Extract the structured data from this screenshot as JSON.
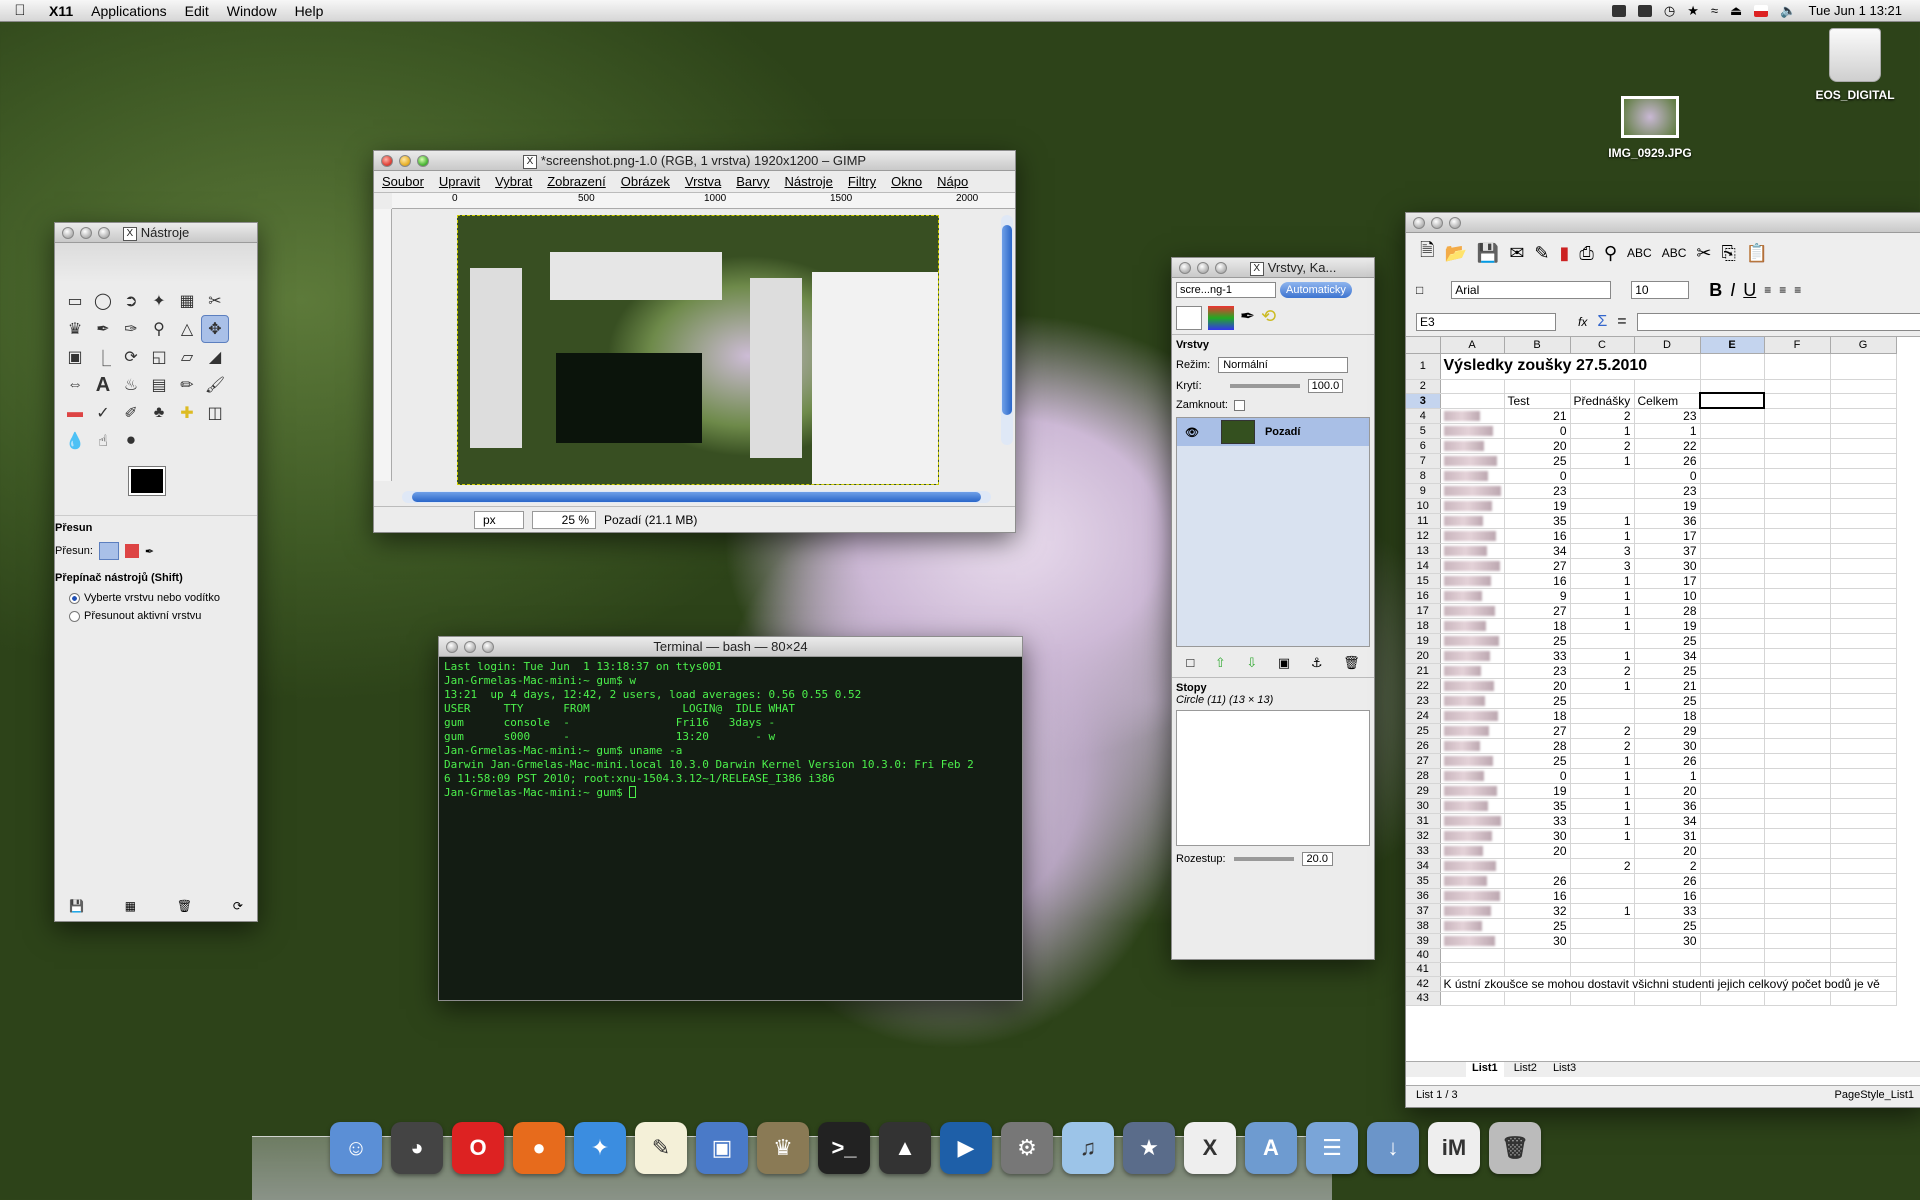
{
  "menubar": {
    "app": "X11",
    "items": [
      "Applications",
      "Edit",
      "Window",
      "Help"
    ],
    "clock": "Tue Jun 1  13:21"
  },
  "desktop": {
    "drive": "EOS_DIGITAL",
    "image": "IMG_0929.JPG"
  },
  "toolbox": {
    "title": "Nástroje",
    "tool_name": "Přesun",
    "move_label": "Přesun:",
    "switch_label": "Přepínač nástrojů  (Shift)",
    "opt1": "Vyberte vrstvu nebo vodítko",
    "opt2": "Přesunout aktivní vrstvu"
  },
  "gimp": {
    "title": "*screenshot.png-1.0 (RGB, 1 vrstva) 1920x1200 – GIMP",
    "menus": [
      "Soubor",
      "Upravit",
      "Vybrat",
      "Zobrazení",
      "Obrázek",
      "Vrstva",
      "Barvy",
      "Nástroje",
      "Filtry",
      "Okno",
      "Nápo"
    ],
    "ruler": [
      "0",
      "500",
      "1000",
      "1500",
      "2000"
    ],
    "unit": "px",
    "zoom": "25 %",
    "status": "Pozadí (21.1 MB)"
  },
  "terminal": {
    "title": "Terminal — bash — 80×24",
    "lines": [
      "Last login: Tue Jun  1 13:18:37 on ttys001",
      "Jan-Grmelas-Mac-mini:~ gum$ w",
      "13:21  up 4 days, 12:42, 2 users, load averages: 0.56 0.55 0.52",
      "USER     TTY      FROM              LOGIN@  IDLE WHAT",
      "gum      console  -                Fri16   3days -",
      "gum      s000     -                13:20       - w",
      "Jan-Grmelas-Mac-mini:~ gum$ uname -a",
      "Darwin Jan-Grmelas-Mac-mini.local 10.3.0 Darwin Kernel Version 10.3.0: Fri Feb 2",
      "6 11:58:09 PST 2010; root:xnu-1504.3.12~1/RELEASE_I386 i386",
      "Jan-Grmelas-Mac-mini:~ gum$ "
    ]
  },
  "layers": {
    "title": "Vrstvy, Ka...",
    "image_combo": "scre...ng-1",
    "auto_btn": "Automaticky",
    "panel": "Vrstvy",
    "mode_label": "Režim:",
    "mode": "Normální",
    "opacity_label": "Krytí:",
    "opacity": "100.0",
    "lock_label": "Zamknout:",
    "layer": "Pozadí",
    "brushes": "Stopy",
    "brush_name": "Circle (11) (13 × 13)",
    "spacing_label": "Rozestup:",
    "spacing": "20.0"
  },
  "calc": {
    "font": "Arial",
    "size": "10",
    "cell": "E3",
    "cols": [
      "A",
      "B",
      "C",
      "D",
      "E",
      "F",
      "G"
    ],
    "title": "Výsledky zoušky 27.5.2010",
    "headers": [
      "Test",
      "Přednášky",
      "Celkem"
    ],
    "rows": [
      [
        "21",
        "2",
        "23"
      ],
      [
        "0",
        "1",
        "1"
      ],
      [
        "20",
        "2",
        "22"
      ],
      [
        "25",
        "1",
        "26"
      ],
      [
        "0",
        "",
        "0"
      ],
      [
        "23",
        "",
        "23"
      ],
      [
        "19",
        "",
        "19"
      ],
      [
        "35",
        "1",
        "36"
      ],
      [
        "16",
        "1",
        "17"
      ],
      [
        "34",
        "3",
        "37"
      ],
      [
        "27",
        "3",
        "30"
      ],
      [
        "16",
        "1",
        "17"
      ],
      [
        "9",
        "1",
        "10"
      ],
      [
        "27",
        "1",
        "28"
      ],
      [
        "18",
        "1",
        "19"
      ],
      [
        "25",
        "",
        "25"
      ],
      [
        "33",
        "1",
        "34"
      ],
      [
        "23",
        "2",
        "25"
      ],
      [
        "20",
        "1",
        "21"
      ],
      [
        "25",
        "",
        "25"
      ],
      [
        "18",
        "",
        "18"
      ],
      [
        "27",
        "2",
        "29"
      ],
      [
        "28",
        "2",
        "30"
      ],
      [
        "25",
        "1",
        "26"
      ],
      [
        "0",
        "1",
        "1"
      ],
      [
        "19",
        "1",
        "20"
      ],
      [
        "35",
        "1",
        "36"
      ],
      [
        "33",
        "1",
        "34"
      ],
      [
        "30",
        "1",
        "31"
      ],
      [
        "20",
        "",
        "20"
      ],
      [
        "",
        "2",
        "2"
      ],
      [
        "26",
        "",
        "26"
      ],
      [
        "16",
        "",
        "16"
      ],
      [
        "32",
        "1",
        "33"
      ],
      [
        "25",
        "",
        "25"
      ],
      [
        "30",
        "",
        "30"
      ]
    ],
    "note": "K ústní zkoušce se mohou dostavit všichni studenti jejich celkový počet bodů je vě",
    "tabs": [
      "List1",
      "List2",
      "List3"
    ],
    "status_left": "List 1 / 3",
    "status_right": "PageStyle_List1"
  },
  "dock": [
    "Finder",
    "Dashboard",
    "Opera",
    "Firefox",
    "Safari",
    "TextEdit",
    "Preview",
    "GIMP",
    "Terminal",
    "Inkscape",
    "QuickTime",
    "System Preferences",
    "iTunes",
    "iPhoto",
    "X11",
    "Applications",
    "Documents",
    "Downloads",
    "iMakers",
    "Trash"
  ]
}
